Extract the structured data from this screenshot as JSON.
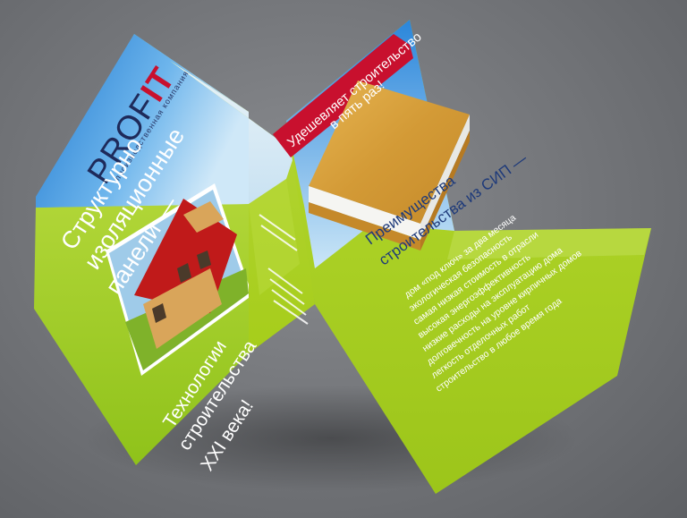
{
  "brand": {
    "logo_part1": "PROF",
    "logo_part2": "IT",
    "subtitle": "производственная компания"
  },
  "front_panel": {
    "headline_line1": "Структурно",
    "headline_line2": "изоляционные",
    "headline_line3": "панели —",
    "tagline_line1": "Технологии",
    "tagline_line2": "строительства",
    "tagline_line3": "XXI века!"
  },
  "right_panel": {
    "banner_line1": "Удешевляет строительство",
    "banner_line2": "в пять раз!",
    "advantages_title_line1": "Преимущества",
    "advantages_title_line2": "строительства из СИП —",
    "bullets": [
      "дом «под ключ» за два месяца",
      "экологическая безопасность",
      "самая низкая стоимость в отрасли",
      "высокая энергоэффективность",
      "низкие расходы на эксплуатацию дома",
      "долговечность на уровне кирпичных домов",
      "легкость отделочных работ",
      "строительство в любое время года"
    ]
  },
  "colors": {
    "sky": "#3d8fd6",
    "grass": "#a9cf1f",
    "brand_red": "#c8102e",
    "brand_navy": "#1e2a5a",
    "background": "#76787c"
  }
}
